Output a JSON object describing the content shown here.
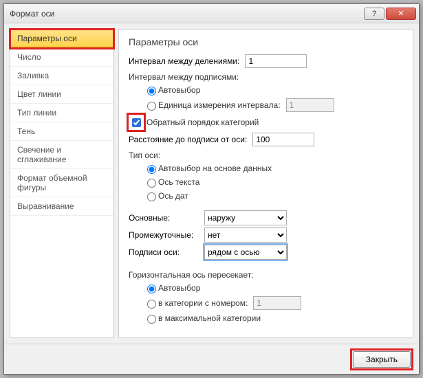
{
  "window": {
    "title": "Формат оси"
  },
  "titlebar": {
    "help": "?",
    "close": "✕"
  },
  "sidebar": {
    "items": [
      {
        "label": "Параметры оси"
      },
      {
        "label": "Число"
      },
      {
        "label": "Заливка"
      },
      {
        "label": "Цвет линии"
      },
      {
        "label": "Тип линии"
      },
      {
        "label": "Тень"
      },
      {
        "label": "Свечение и сглаживание"
      },
      {
        "label": "Формат объемной фигуры"
      },
      {
        "label": "Выравнивание"
      }
    ]
  },
  "panel": {
    "heading": "Параметры оси",
    "interval_divisions_label": "Интервал между делениями:",
    "interval_divisions_value": "1",
    "interval_labels_label": "Интервал между подписями:",
    "auto_label": "Автовыбор",
    "unit_label": "Единица измерения интервала:",
    "unit_value": "1",
    "reverse_label": "Обратный порядок категорий",
    "distance_label": "Расстояние до подписи от оси:",
    "distance_value": "100",
    "axis_type_label": "Тип оси:",
    "axis_type_auto": "Автовыбор на основе данных",
    "axis_type_text": "Ось текста",
    "axis_type_date": "Ось дат",
    "major_label": "Основные:",
    "major_value": "наружу",
    "minor_label": "Промежуточные:",
    "minor_value": "нет",
    "captions_label": "Подписи оси:",
    "captions_value": "рядом с осью",
    "cross_label": "Горизонтальная ось пересекает:",
    "cross_auto": "Автовыбор",
    "cross_catnum": "в категории с номером:",
    "cross_catnum_value": "1",
    "cross_max": "в максимальной категории"
  },
  "footer": {
    "close_label": "Закрыть"
  }
}
